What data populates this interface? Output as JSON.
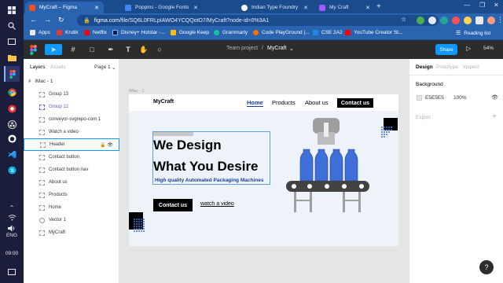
{
  "taskbar": {
    "items": [
      "windows-start",
      "search",
      "task-view",
      "file-explorer",
      "figma-app",
      "chrome",
      "vpn",
      "obs",
      "github",
      "vscode",
      "skype"
    ],
    "language": "ENG",
    "time": "09:00"
  },
  "browser": {
    "tabs": [
      {
        "title": "MyCraft – Figma",
        "active": true,
        "icon_color": "#f24e1e"
      },
      {
        "title": "Poppins - Google Fonts",
        "active": false,
        "icon_color": "#4285f4"
      },
      {
        "title": "Indian Type Foundry",
        "active": false,
        "icon_color": "#ffffff"
      },
      {
        "title": "My Craft",
        "active": false,
        "icon_color": "#a259ff"
      }
    ],
    "address_host": "figma.com",
    "address_path": "/file/SQ6L0FRLpIAWO4YCQQotO7/MyCraft?node-id=0%3A1",
    "bookmarks": [
      {
        "label": "Apps",
        "color": "#e8e8e8"
      },
      {
        "label": "Krutik",
        "color": "#e53935"
      },
      {
        "label": "Netflix",
        "color": "#e50914"
      },
      {
        "label": "Disney+ Hotstar -...",
        "color": "#0d1b4c"
      },
      {
        "label": "Google Keep",
        "color": "#fbbc04"
      },
      {
        "label": "Grammarly",
        "color": "#15c39a"
      },
      {
        "label": "Code PlayGround |...",
        "color": "#ff6d00"
      },
      {
        "label": "CSE 2A2",
        "color": "#1e88e5"
      },
      {
        "label": "YouTube Creator St...",
        "color": "#ff0000"
      }
    ],
    "reading_list": "Reading list"
  },
  "figma": {
    "team": "Team project",
    "file_name": "MyCraft",
    "share_label": "Share",
    "zoom": "54%",
    "layers_panel": {
      "tabs": [
        "Layers",
        "Assets"
      ],
      "page": "Page 1",
      "frame": "iMac - 1",
      "layers": [
        {
          "name": "Group 13",
          "type": "group"
        },
        {
          "name": "Group 12",
          "type": "group-highlight"
        },
        {
          "name": "conveyor-svgrepo-com 1",
          "type": "item"
        },
        {
          "name": "Watch a video",
          "type": "item"
        },
        {
          "name": "Header",
          "type": "selected"
        },
        {
          "name": "Contact button",
          "type": "item"
        },
        {
          "name": "Contact button nav",
          "type": "item"
        },
        {
          "name": "About us",
          "type": "item"
        },
        {
          "name": "Products",
          "type": "item"
        },
        {
          "name": "Home",
          "type": "item"
        },
        {
          "name": "Vector 1",
          "type": "item"
        },
        {
          "name": "MyCraft",
          "type": "item"
        }
      ]
    },
    "canvas": {
      "frame_label": "iMac - 1",
      "background": "#e5e5e5",
      "site": {
        "logo": "MyCraft",
        "nav": [
          "Home",
          "Products",
          "About us"
        ],
        "nav_active": "Home",
        "contact_nav": "Contact us",
        "headline_1": "We Design",
        "headline_2": "What You Desire",
        "subheadline": "High quality  Automated Packaging Machines",
        "cta": "Contact us",
        "video_link": "watch a video",
        "accent_color": "#1a3d9c",
        "bottle_color": "#3f6fd8"
      }
    },
    "design_panel": {
      "tabs": [
        "Design",
        "Prototype",
        "Inspect"
      ],
      "active_tab": "Design",
      "background_label": "Background",
      "bg_hex": "E5E5E5",
      "bg_opacity": "100%",
      "export_label": "Export",
      "help": "?"
    }
  }
}
